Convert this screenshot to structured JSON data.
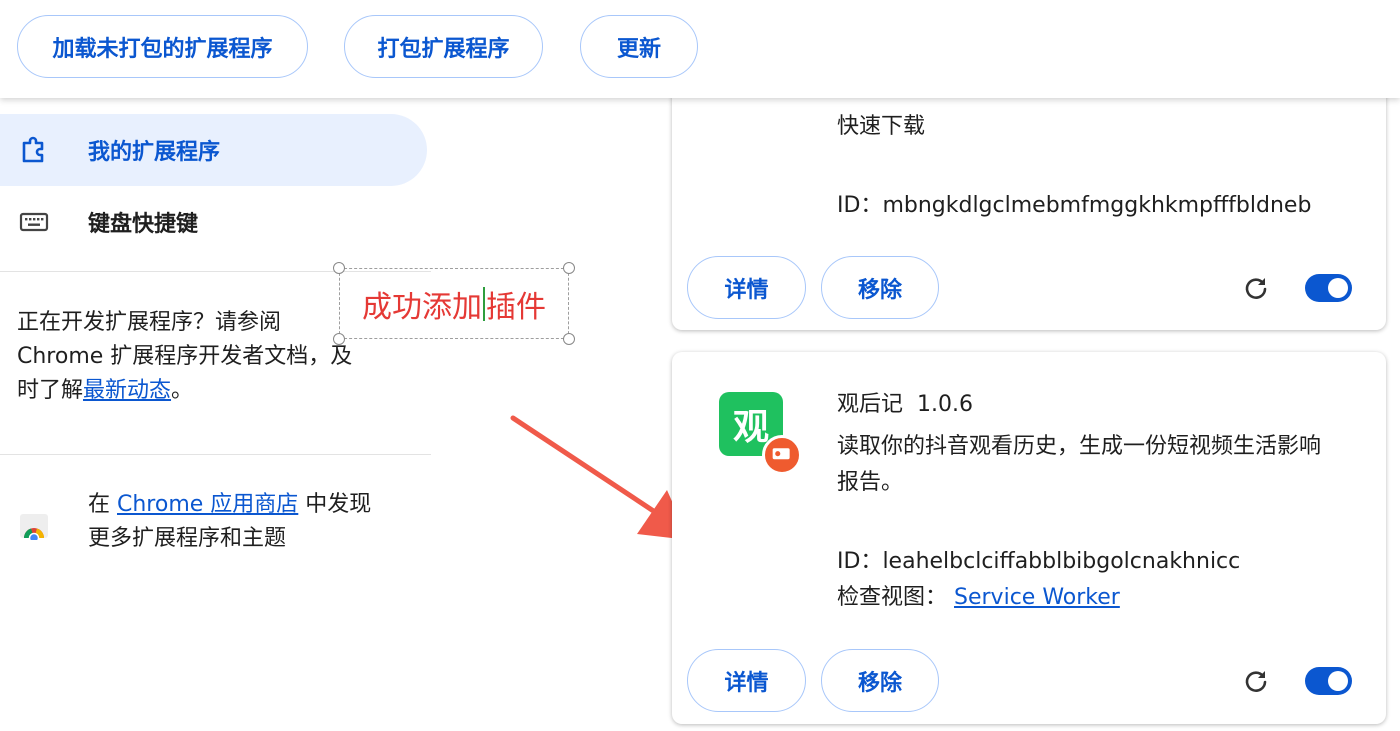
{
  "toolbar": {
    "load_unpacked_label": "加载未打包的扩展程序",
    "pack_label": "打包扩展程序",
    "update_label": "更新"
  },
  "sidebar": {
    "items": [
      {
        "label": "我的扩展程序",
        "icon": "extension-icon",
        "active": true
      },
      {
        "label": "键盘快捷键",
        "icon": "keyboard-icon",
        "active": false
      }
    ],
    "dev_text_before": "正在开发扩展程序？请参阅 Chrome 扩展程序开发者文档，及时了解",
    "dev_link": "最新动态",
    "dev_text_after": "。",
    "store_prefix": "在 ",
    "store_link": "Chrome 应用商店",
    "store_suffix": " 中发现更多扩展程序和主题"
  },
  "annotation": {
    "text_before": "成功添加",
    "text_after": "插件",
    "color": "#e53935"
  },
  "extensions": [
    {
      "description": "快速下载",
      "id_label": "ID：",
      "id": "mbngkdlgclmebmfmggkhkmpfffbldneb",
      "details_label": "详情",
      "remove_label": "移除",
      "enabled": true
    },
    {
      "name": "观后记",
      "version": "1.0.6",
      "icon_char": "观",
      "description_line1": "读取你的抖音观看历史，生成一份短视频生活影响",
      "description_line2": "报告。",
      "id_label": "ID：",
      "id": "leahelbclciffabblbibgolcnakhnicc",
      "inspect_label": "检查视图：",
      "inspect_link": "Service Worker",
      "details_label": "详情",
      "remove_label": "移除",
      "enabled": true
    }
  ],
  "colors": {
    "accent": "#0b57d0",
    "active_nav_bg": "#e8f0fe",
    "icon_green": "#1fc15f",
    "badge_orange": "#ef5b2f",
    "arrow": "#f05a4a"
  }
}
